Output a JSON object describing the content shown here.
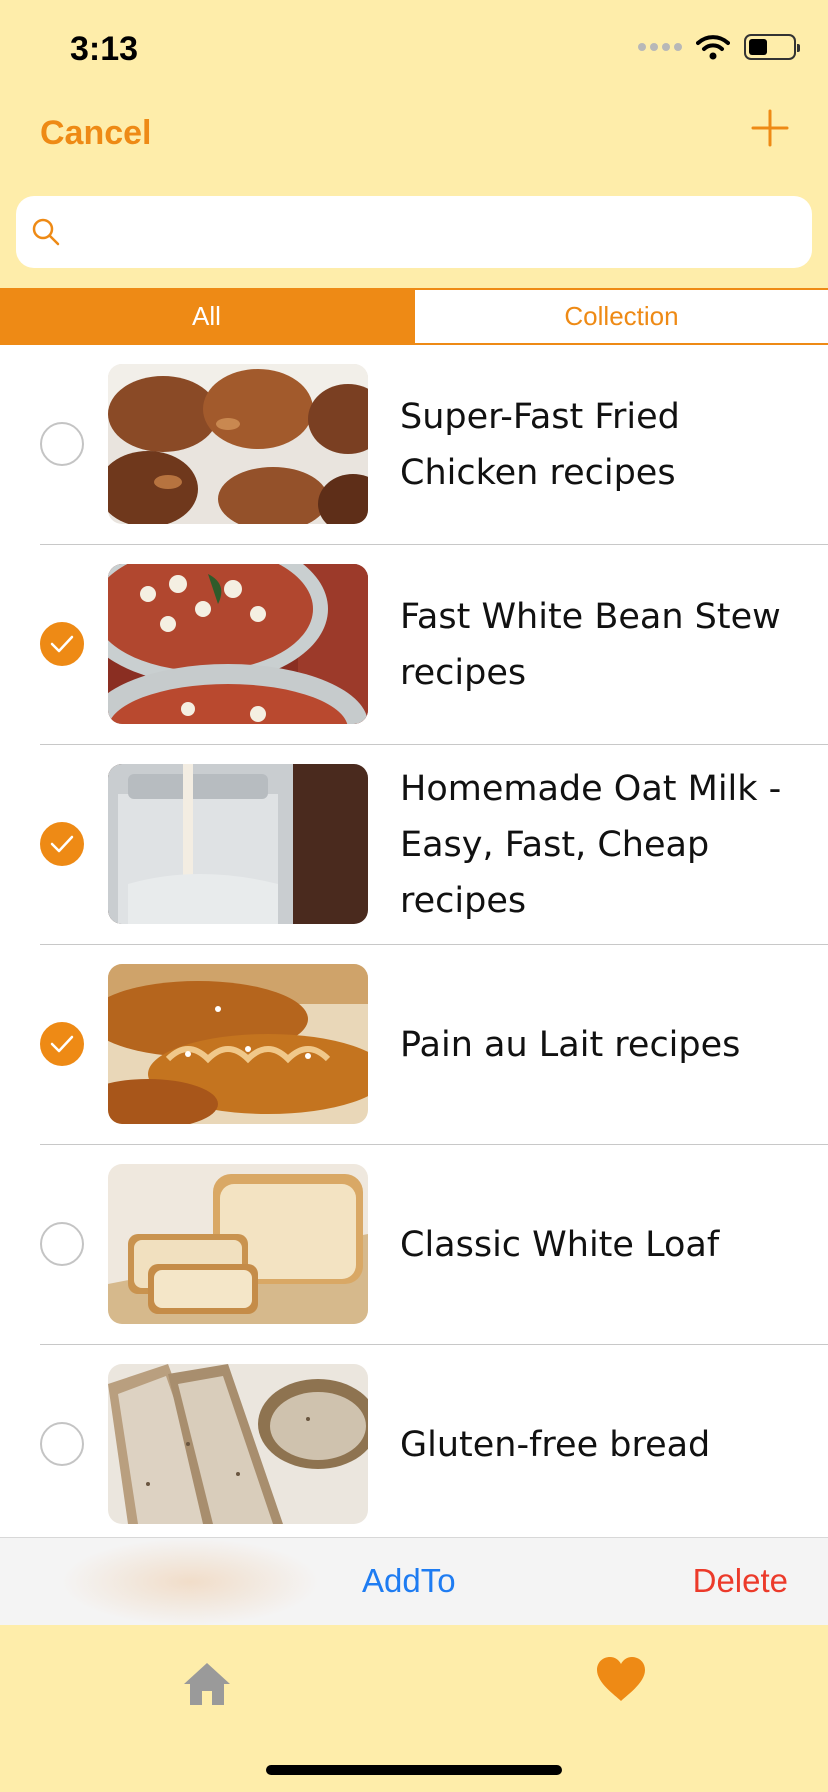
{
  "status_bar": {
    "time": "3:13",
    "icons": [
      "signal-icon",
      "wifi-icon",
      "battery-icon"
    ]
  },
  "nav": {
    "cancel_label": "Cancel",
    "add_icon": "plus-icon"
  },
  "search": {
    "placeholder": "",
    "value": "",
    "icon": "search-icon"
  },
  "segments": [
    {
      "label": "All",
      "selected": true
    },
    {
      "label": "Collection",
      "selected": false
    }
  ],
  "recipes": [
    {
      "title": "Super-Fast Fried Chicken recipes",
      "checked": false
    },
    {
      "title": "Fast White Bean Stew recipes",
      "checked": true
    },
    {
      "title": "Homemade Oat Milk - Easy, Fast, Cheap recipes",
      "checked": true
    },
    {
      "title": "Pain au Lait recipes",
      "checked": true
    },
    {
      "title": "Classic White Loaf",
      "checked": false
    },
    {
      "title": "Gluten-free bread",
      "checked": false
    }
  ],
  "toolbar": {
    "addto_label": "AddTo",
    "delete_label": "Delete"
  },
  "tab_bar": {
    "items": [
      {
        "icon": "home-icon",
        "selected": false
      },
      {
        "icon": "heart-icon",
        "selected": true
      }
    ]
  },
  "colors": {
    "accent": "#EE8A15",
    "background": "#FEEDAA",
    "link_blue": "#1E7CF2",
    "delete_red": "#EC3A2A"
  }
}
